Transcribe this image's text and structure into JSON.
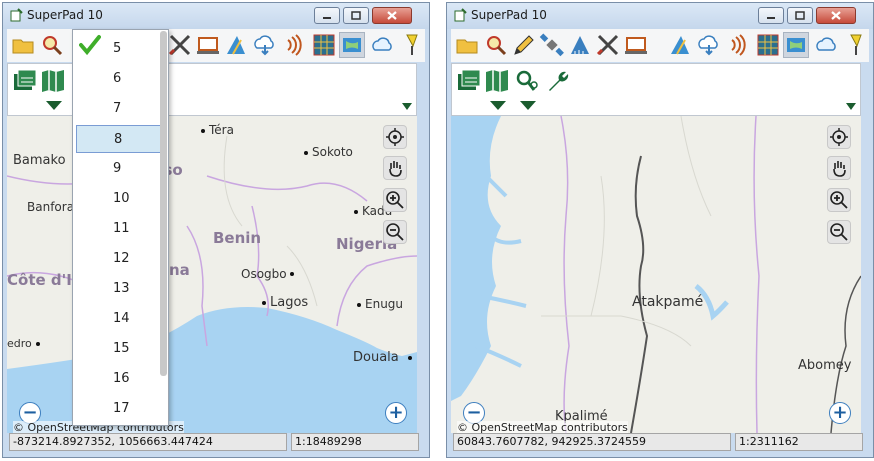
{
  "left_window": {
    "title": "SuperPad 10",
    "map_labels": {
      "countries": [
        "Faso",
        "Benin",
        "Nigeria",
        "Côte d'I",
        "na"
      ],
      "cities": [
        "Téra",
        "Sokoto",
        "Bamako",
        "Banfora",
        "Kadu",
        "Osogbo",
        "Lagos",
        "Enugu",
        "edro",
        "Douala"
      ]
    },
    "dropdown_items": [
      "5",
      "6",
      "7",
      "8",
      "9",
      "10",
      "11",
      "12",
      "13",
      "14",
      "15",
      "16",
      "17"
    ],
    "dropdown_selected": "8",
    "attribution": "© OpenStreetMap contributors",
    "status_coords": "-873214.8927352, 1056663.447424",
    "status_scale": "1:18489298"
  },
  "right_window": {
    "title": "SuperPad 10",
    "map_labels": {
      "cities": [
        "Atakpamé",
        "Kpalimé",
        "Abomey"
      ]
    },
    "attribution": "© OpenStreetMap contributors",
    "status_coords": "60843.7607782, 942925.3724559",
    "status_scale": "1:2311162"
  },
  "colors": {
    "water": "#a8d3f2",
    "border": "#c9a6e0",
    "accent": "#1a5c2e"
  }
}
